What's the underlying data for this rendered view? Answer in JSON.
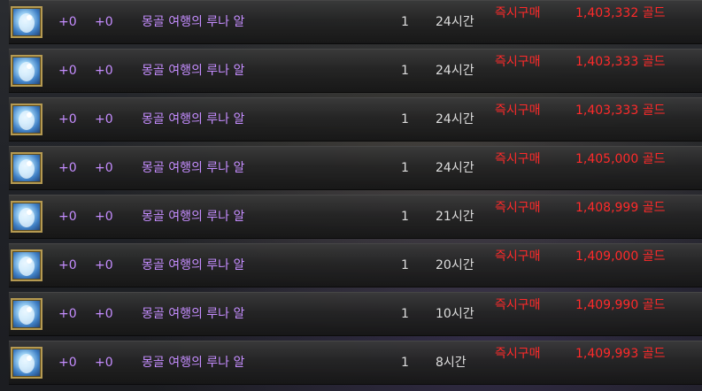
{
  "listings": [
    {
      "enhance": "+0",
      "refine": "+0",
      "item_name": "몽골 여행의 루나 알",
      "quantity": "1",
      "time_left": "24시간",
      "buy_label": "즉시구매",
      "price": "1,403,332 골드"
    },
    {
      "enhance": "+0",
      "refine": "+0",
      "item_name": "몽골 여행의 루나 알",
      "quantity": "1",
      "time_left": "24시간",
      "buy_label": "즉시구매",
      "price": "1,403,333 골드"
    },
    {
      "enhance": "+0",
      "refine": "+0",
      "item_name": "몽골 여행의 루나 알",
      "quantity": "1",
      "time_left": "24시간",
      "buy_label": "즉시구매",
      "price": "1,403,333 골드"
    },
    {
      "enhance": "+0",
      "refine": "+0",
      "item_name": "몽골 여행의 루나 알",
      "quantity": "1",
      "time_left": "24시간",
      "buy_label": "즉시구매",
      "price": "1,405,000 골드"
    },
    {
      "enhance": "+0",
      "refine": "+0",
      "item_name": "몽골 여행의 루나 알",
      "quantity": "1",
      "time_left": "21시간",
      "buy_label": "즉시구매",
      "price": "1,408,999 골드"
    },
    {
      "enhance": "+0",
      "refine": "+0",
      "item_name": "몽골 여행의 루나 알",
      "quantity": "1",
      "time_left": "20시간",
      "buy_label": "즉시구매",
      "price": "1,409,000 골드"
    },
    {
      "enhance": "+0",
      "refine": "+0",
      "item_name": "몽골 여행의 루나 알",
      "quantity": "1",
      "time_left": "10시간",
      "buy_label": "즉시구매",
      "price": "1,409,990 골드"
    },
    {
      "enhance": "+0",
      "refine": "+0",
      "item_name": "몽골 여행의 루나 알",
      "quantity": "1",
      "time_left": "8시간",
      "buy_label": "즉시구매",
      "price": "1,409,993 골드"
    }
  ],
  "icon": "luna-egg-icon",
  "colors": {
    "item_name": "#c58dff",
    "price": "#ff2a2a",
    "neutral_text": "#dddddd",
    "icon_border": "#b59a52"
  }
}
